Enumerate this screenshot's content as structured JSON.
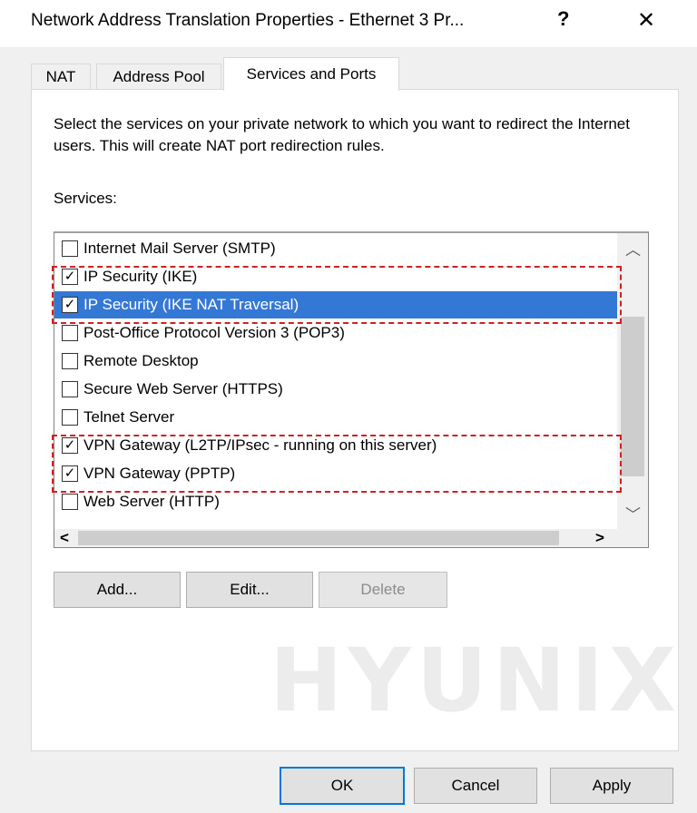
{
  "window": {
    "title": "Network Address Translation Properties - Ethernet 3 Pr...",
    "help_label": "?",
    "close_label": "✕"
  },
  "tabs": [
    {
      "label": "NAT",
      "active": false
    },
    {
      "label": "Address Pool",
      "active": false
    },
    {
      "label": "Services and Ports",
      "active": true
    }
  ],
  "panel": {
    "description": "Select the services on your private network to which you want to redirect the Internet users. This will create NAT port redirection rules.",
    "services_label": "Services:"
  },
  "services": [
    {
      "label": "Internet Mail Server (SMTP)",
      "checked": false,
      "selected": false
    },
    {
      "label": "IP Security (IKE)",
      "checked": true,
      "selected": false
    },
    {
      "label": "IP Security (IKE NAT Traversal)",
      "checked": true,
      "selected": true
    },
    {
      "label": "Post-Office Protocol Version 3 (POP3)",
      "checked": false,
      "selected": false
    },
    {
      "label": "Remote Desktop",
      "checked": false,
      "selected": false
    },
    {
      "label": "Secure Web Server (HTTPS)",
      "checked": false,
      "selected": false
    },
    {
      "label": "Telnet Server",
      "checked": false,
      "selected": false
    },
    {
      "label": "VPN Gateway (L2TP/IPsec - running on this server)",
      "checked": true,
      "selected": false
    },
    {
      "label": "VPN Gateway (PPTP)",
      "checked": true,
      "selected": false
    },
    {
      "label": "Web Server (HTTP)",
      "checked": false,
      "selected": false
    }
  ],
  "list_buttons": {
    "add": "Add...",
    "edit": "Edit...",
    "delete": "Delete"
  },
  "dialog_buttons": {
    "ok": "OK",
    "cancel": "Cancel",
    "apply": "Apply"
  },
  "watermark": "HYUNIX",
  "colors": {
    "selection": "#3478d6",
    "highlight": "#d02020",
    "default_button_border": "#0078d7"
  }
}
